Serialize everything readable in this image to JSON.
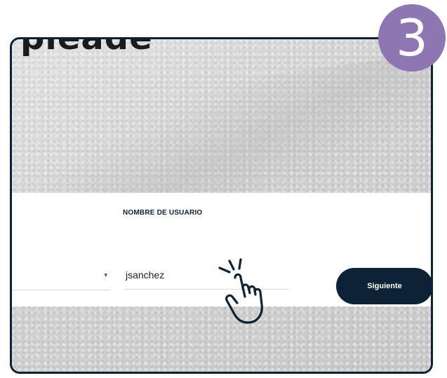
{
  "logo": {
    "text": "pleade"
  },
  "step": {
    "number": "3"
  },
  "form": {
    "label": "NOMBRE DE USUARIO",
    "username_value": "jsanchez",
    "next_label": "Siguiente"
  },
  "icons": {
    "caret": "chevron-down-icon",
    "hand": "tap-hand-icon"
  },
  "colors": {
    "navy": "#0d2235",
    "badge": "#8e76b3"
  }
}
